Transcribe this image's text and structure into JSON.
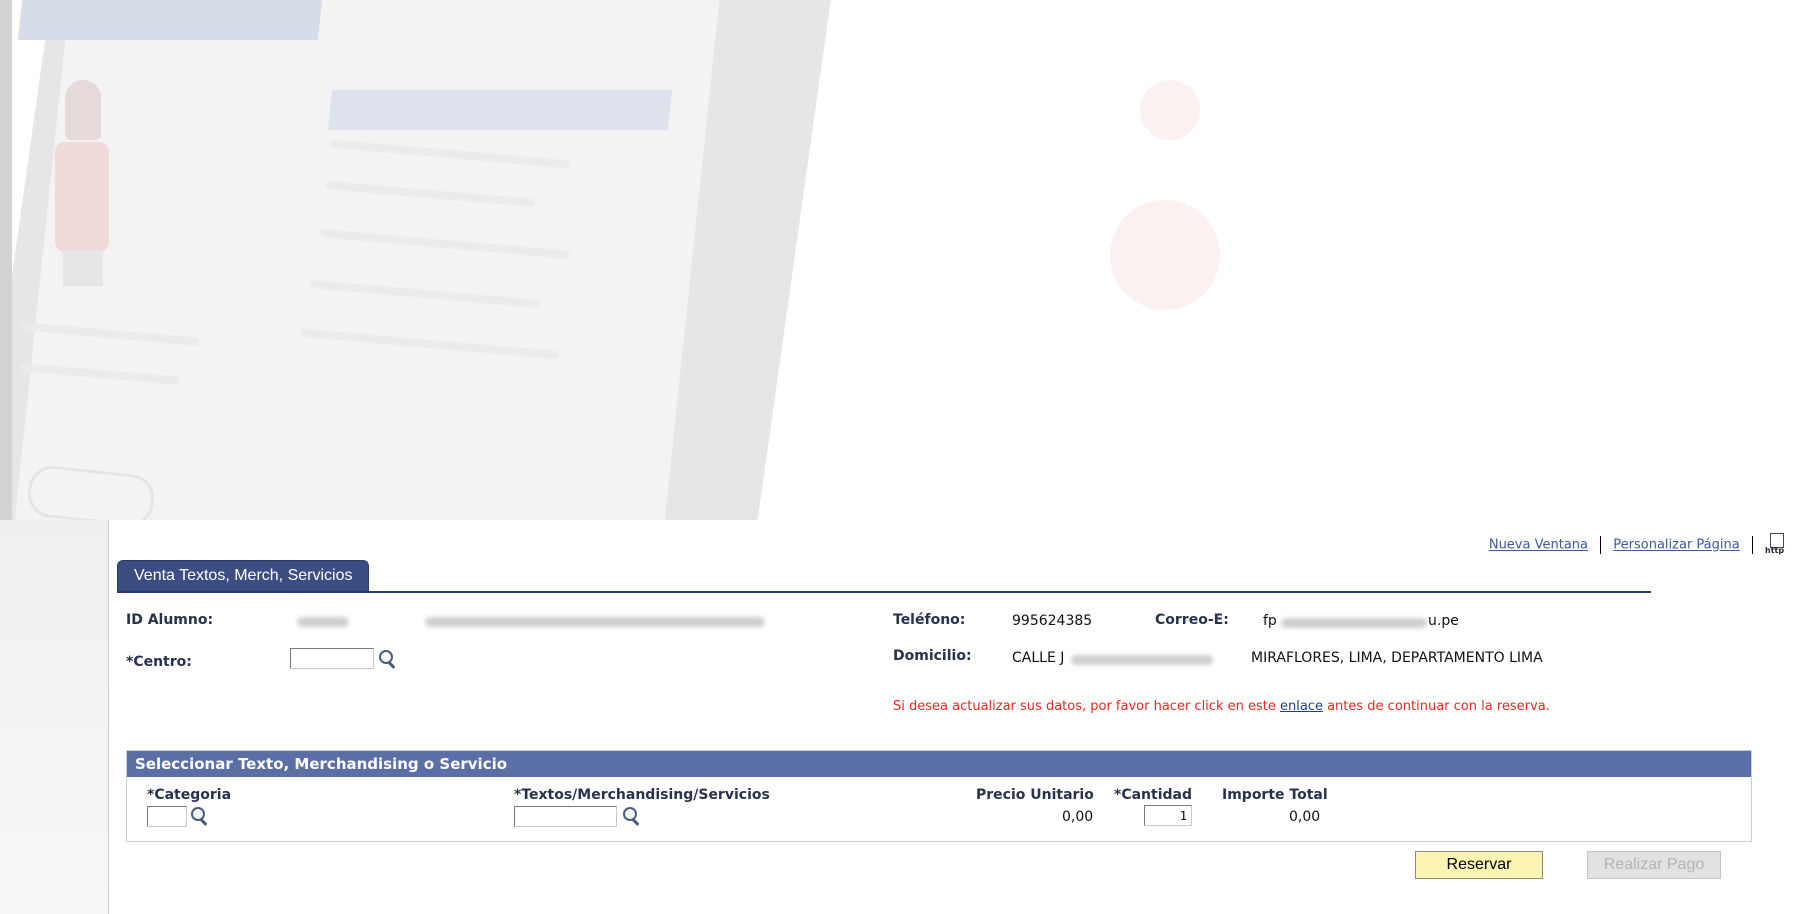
{
  "links": {
    "new_window": "Nueva Ventana",
    "personalize": "Personalizar Página",
    "http_icon_text": "http"
  },
  "tab": {
    "label": "Venta Textos, Merch, Servicios"
  },
  "student": {
    "id_label": "ID Alumno:",
    "centro_label": "*Centro:",
    "centro_value": "",
    "phone_label": "Teléfono:",
    "phone_value": "995624385",
    "email_label": "Correo-E:",
    "email_prefix": "fp",
    "email_suffix": "u.pe",
    "address_label": "Domicilio:",
    "address_prefix": "CALLE J",
    "address_suffix": "MIRAFLORES, LIMA, DEPARTAMENTO LIMA"
  },
  "notice": {
    "before": "Si desea actualizar sus datos, por favor hacer click en este ",
    "link": "enlace",
    "after": " antes de continuar con la reserva."
  },
  "grid": {
    "title": "Seleccionar Texto, Merchandising o Servicio",
    "col_categoria": "*Categoria",
    "col_textos": "*Textos/Merchandising/Servicios",
    "col_precio": "Precio Unitario",
    "col_cantidad": "*Cantidad",
    "col_importe": "Importe Total",
    "categoria_value": "",
    "textos_value": "",
    "precio_value": "0,00",
    "cantidad_value": "1",
    "importe_value": "0,00"
  },
  "buttons": {
    "reservar": "Reservar",
    "realizar_pago": "Realizar Pago"
  }
}
